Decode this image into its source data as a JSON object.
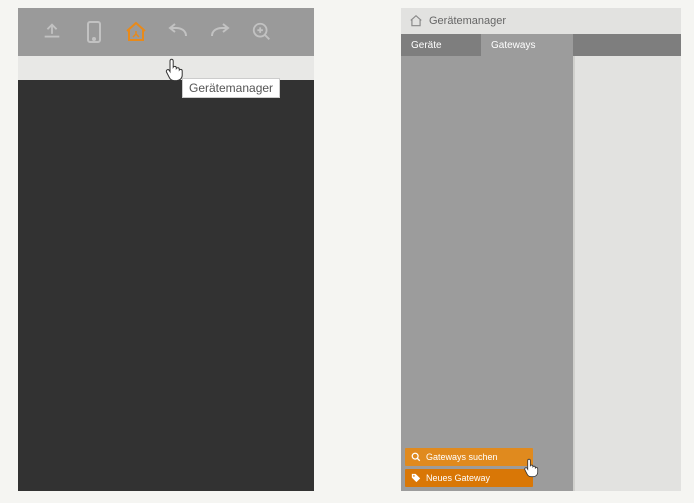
{
  "left": {
    "tooltip": "Gerätemanager",
    "icons": {
      "upload": "upload-icon",
      "mobile": "mobile-icon",
      "house": "house-icon",
      "undo": "undo-icon",
      "redo": "redo-icon",
      "zoom": "zoom-in-icon"
    }
  },
  "right": {
    "title": "Gerätemanager",
    "tabs": {
      "devices": "Geräte",
      "gateways": "Gateways"
    },
    "actions": {
      "search": "Gateways suchen",
      "new": "Neues Gateway"
    }
  }
}
